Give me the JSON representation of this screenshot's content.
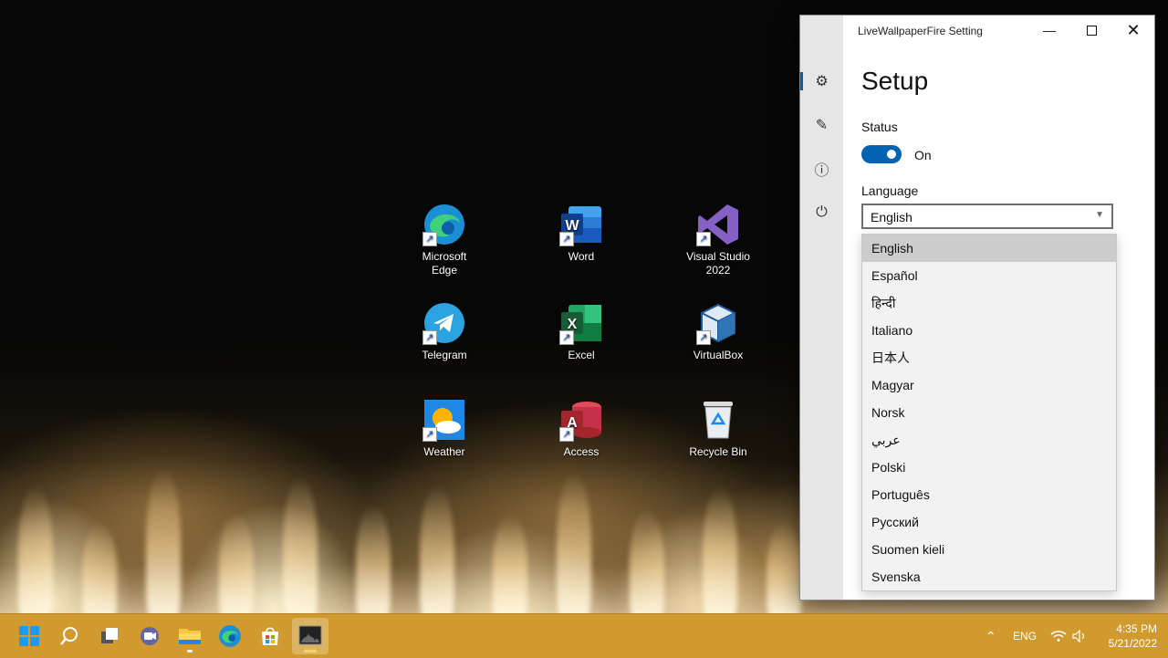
{
  "desktop": {
    "icons": [
      {
        "label": "Microsoft\nEdge",
        "icon": "edge-icon"
      },
      {
        "label": "Word",
        "icon": "word-icon"
      },
      {
        "label": "Visual Studio\n2022",
        "icon": "visual-studio-icon"
      },
      {
        "label": "Telegram",
        "icon": "telegram-icon"
      },
      {
        "label": "Excel",
        "icon": "excel-icon"
      },
      {
        "label": "VirtualBox",
        "icon": "virtualbox-icon"
      },
      {
        "label": "Weather",
        "icon": "weather-icon"
      },
      {
        "label": "Access",
        "icon": "access-icon"
      },
      {
        "label": "Recycle Bin",
        "icon": "recycle-bin-icon"
      }
    ]
  },
  "window": {
    "title": "LiveWallpaperFire Setting",
    "sidebar": [
      "settings-icon",
      "edit-icon",
      "info-icon",
      "power-icon"
    ],
    "page_title": "Setup",
    "status_label": "Status",
    "status_value": "On",
    "language_label": "Language",
    "language_selected": "English",
    "language_options": [
      "English",
      "Español",
      "हिन्दी",
      "Italiano",
      "日本人",
      "Magyar",
      "Norsk",
      "عربي",
      "Polski",
      "Português",
      "Русский",
      "Suomen kieli",
      "Svenska"
    ]
  },
  "taskbar": {
    "items": [
      "start-icon",
      "search-icon",
      "task-view-icon",
      "chat-icon",
      "file-explorer-icon",
      "edge-icon",
      "store-icon",
      "live-wallpaper-icon"
    ],
    "language": "ENG",
    "time": "4:35 PM",
    "date": "5/21/2022"
  },
  "colors": {
    "accent": "#0063b1",
    "taskbar": "#d19a2f"
  }
}
